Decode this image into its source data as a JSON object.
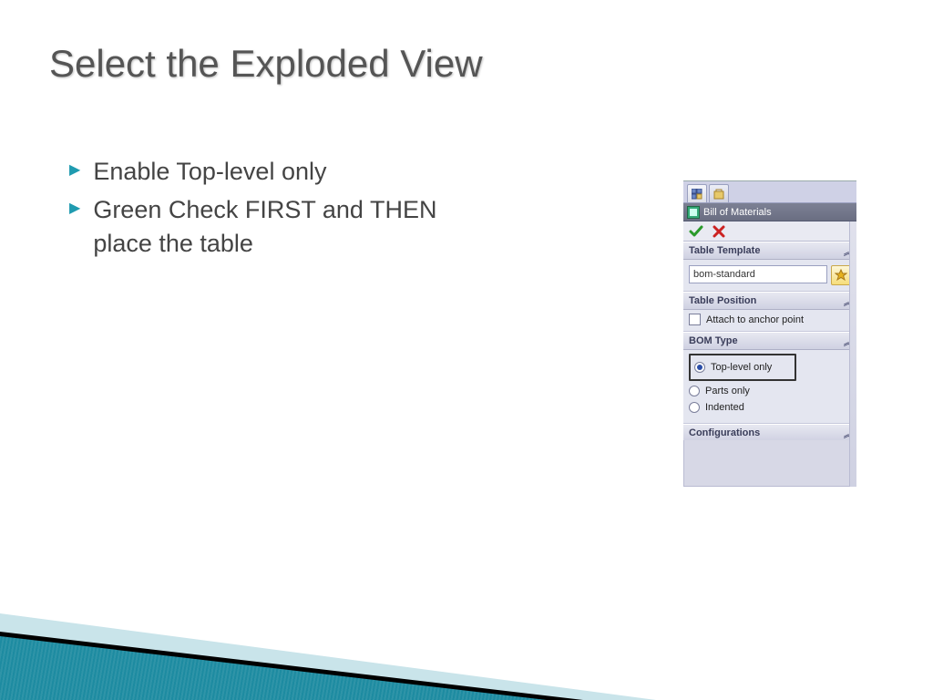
{
  "title": "Select the Exploded View",
  "bullets": [
    "Enable Top-level only",
    "Green Check FIRST and THEN place the table"
  ],
  "panel": {
    "header": "Bill of Materials",
    "sections": {
      "template": {
        "label": "Table Template",
        "value": "bom-standard"
      },
      "position": {
        "label": "Table Position",
        "checkbox": "Attach to anchor point"
      },
      "bomtype": {
        "label": "BOM Type",
        "options": [
          "Top-level only",
          "Parts only",
          "Indented"
        ],
        "selected": 0
      },
      "config": {
        "label": "Configurations"
      }
    }
  }
}
